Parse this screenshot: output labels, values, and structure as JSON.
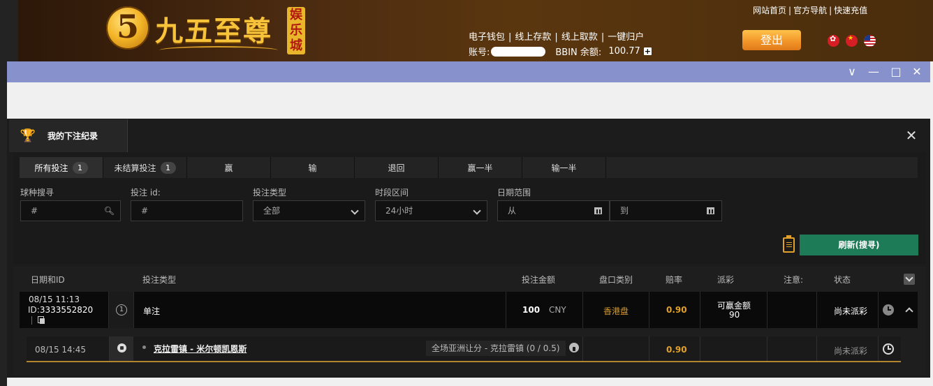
{
  "header": {
    "brand_badge": "5",
    "brand_name": "九五至尊",
    "brand_seal": "娱乐城",
    "top_links": [
      "网站首页",
      "官方导航",
      "快速充值"
    ],
    "link_separator": "|",
    "wallet_links": [
      "电子钱包",
      "线上存款",
      "线上取款",
      "一键归户"
    ],
    "account_label": "账号:",
    "balance_label": "BBIN 余额:",
    "balance_value": "100.77",
    "plus": "+",
    "login_label": "登出",
    "flags": [
      "flag-hk-icon",
      "flag-cn-icon",
      "flag-us-icon"
    ]
  },
  "window": {
    "controls": [
      "∨",
      "—",
      "□",
      "✕"
    ]
  },
  "panel": {
    "title": "我的下注纪录",
    "close": "✕"
  },
  "tabs": [
    {
      "label": "所有投注",
      "count": "1"
    },
    {
      "label": "未结算投注",
      "count": "1"
    },
    {
      "label": "赢"
    },
    {
      "label": "输"
    },
    {
      "label": "退回"
    },
    {
      "label": "赢一半"
    },
    {
      "label": "输一半"
    }
  ],
  "filters": {
    "sport_label": "球种搜寻",
    "sport_placeholder": "#",
    "bet_id_label": "投注 id:",
    "bet_id_placeholder": "#",
    "bet_type_label": "投注类型",
    "bet_type_value": "全部",
    "period_label": "时段区间",
    "period_value": "24小时",
    "date_range_label": "日期范围",
    "date_from": "从",
    "date_to": "到"
  },
  "refresh_label": "刷新(搜寻)",
  "table": {
    "headers": [
      "日期和ID",
      "投注类型",
      "投注金额",
      "盘口类别",
      "赔率",
      "派彩",
      "注意:",
      "状态"
    ],
    "row": {
      "date": "08/15 11:13",
      "id_prefix": "ID:",
      "id": "3333552820",
      "leg_count": "1",
      "bet_type": "单注",
      "amount": "100",
      "currency": "CNY",
      "odds_type": "香港盘",
      "odds": "0.90",
      "payout_label": "可赢金额",
      "payout_value": "90",
      "status": "尚未派彩"
    },
    "sub_row": {
      "time": "08/15 14:45",
      "match": "克拉雷镇 - 米尔顿凯恩斯",
      "market": "全场亚洲让分 - 克拉雷镇 (0 / 0.5)",
      "odds": "0.90",
      "status": "尚未派彩"
    }
  },
  "colors": {
    "accent_gold": "#e2a12a",
    "refresh_green": "#1d7b57",
    "titlebar": "#8791cc"
  }
}
